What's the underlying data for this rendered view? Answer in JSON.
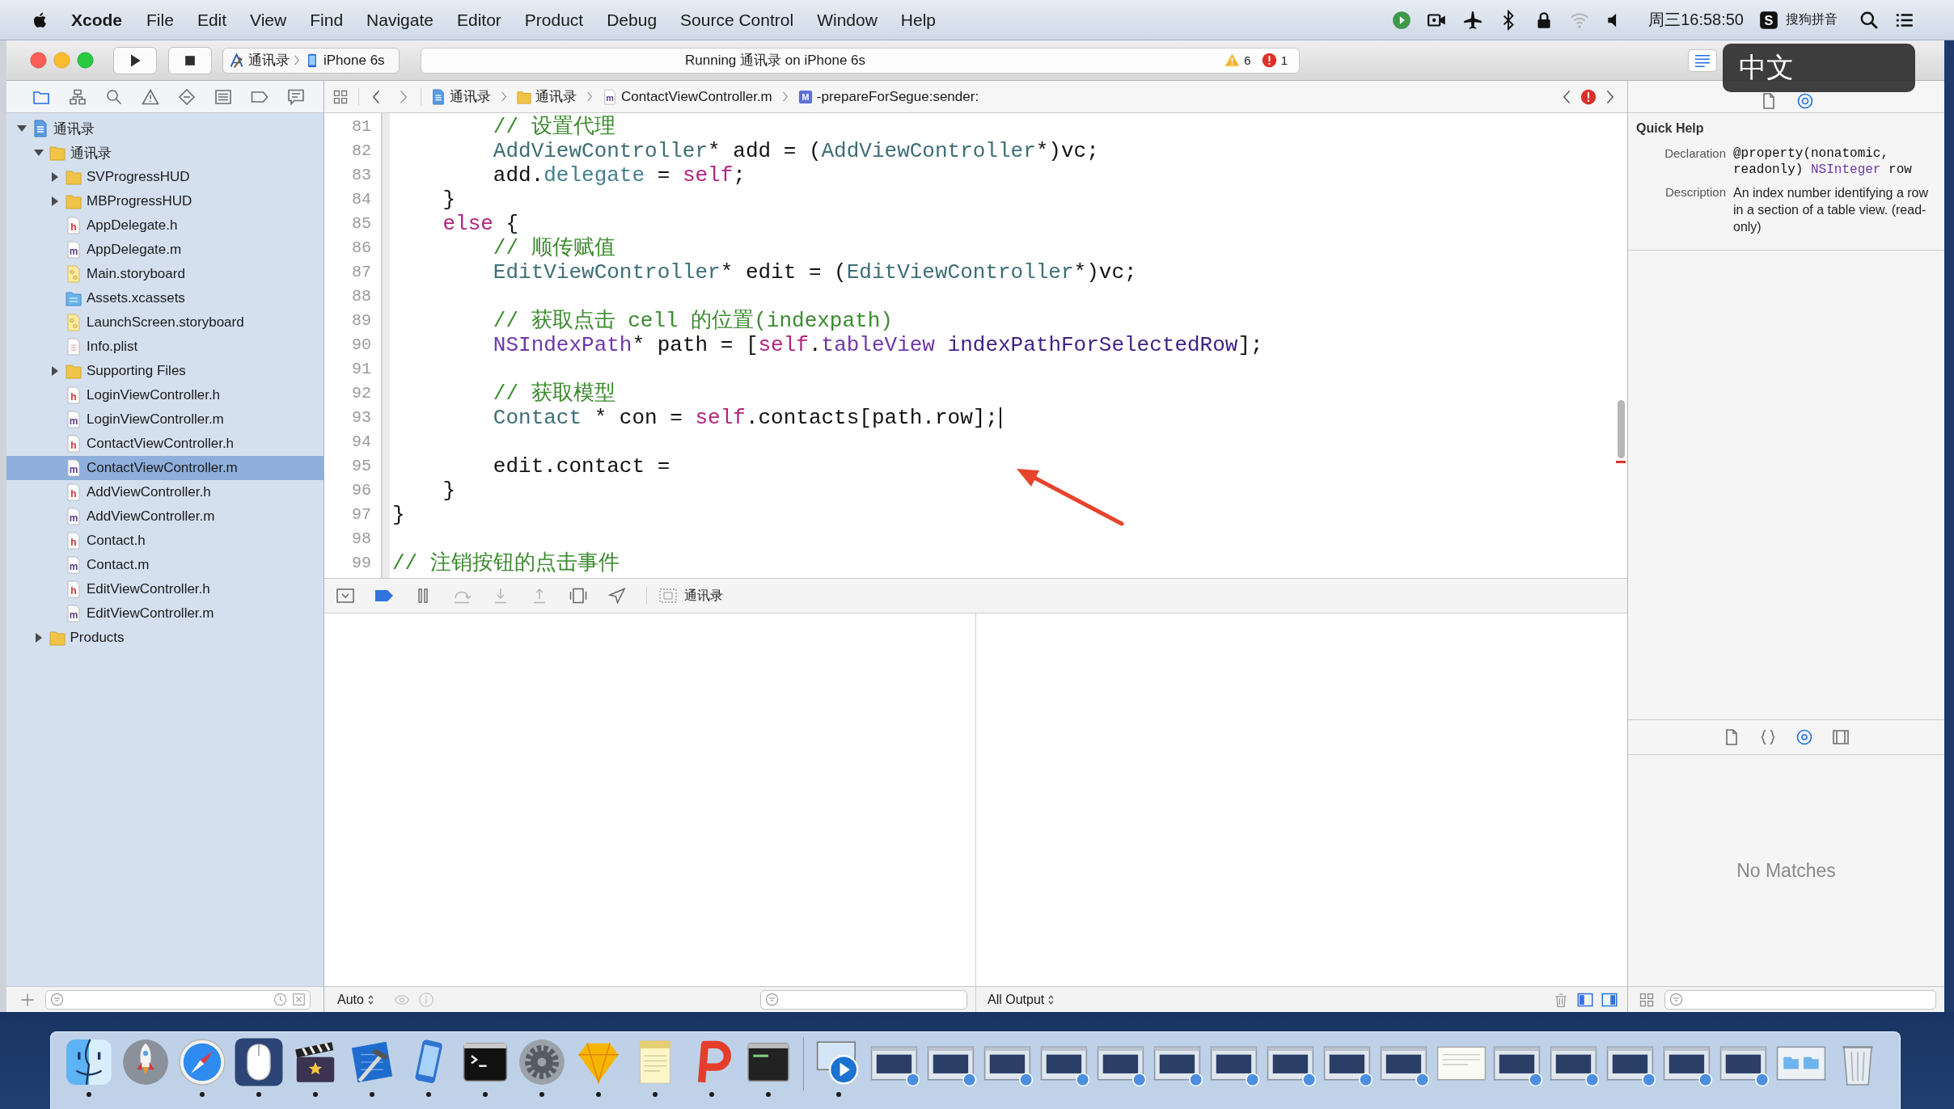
{
  "menu_bar": {
    "app": "Xcode",
    "items": [
      "File",
      "Edit",
      "View",
      "Find",
      "Navigate",
      "Editor",
      "Product",
      "Debug",
      "Source Control",
      "Window",
      "Help"
    ],
    "clock": "周三16:58:50",
    "input_method": {
      "badge": "S",
      "label": "搜狗拼音"
    }
  },
  "toolbar": {
    "scheme": "通讯录",
    "device": "iPhone 6s",
    "activity": "Running 通讯录 on iPhone 6s",
    "warnings": "6",
    "errors": "1",
    "standard_editor": {
      "selected": true
    }
  },
  "ime_popup": {
    "text": "中文"
  },
  "navigator": {
    "tabs": [
      {
        "kind": "project",
        "selected": true
      },
      {
        "kind": "symbol",
        "selected": false
      },
      {
        "kind": "find",
        "selected": false
      },
      {
        "kind": "issue",
        "selected": false
      },
      {
        "kind": "test",
        "selected": false
      },
      {
        "kind": "debug",
        "selected": false
      },
      {
        "kind": "breakpoint",
        "selected": false
      },
      {
        "kind": "report",
        "selected": false
      }
    ],
    "tree": [
      {
        "label": "通讯录",
        "kind": "project",
        "expanded": true,
        "selected": false,
        "children": [
          {
            "label": "通讯录",
            "kind": "folder",
            "expanded": true,
            "selected": false,
            "children": [
              {
                "label": "SVProgressHUD",
                "kind": "folder",
                "expanded": false,
                "selected": false
              },
              {
                "label": "MBProgressHUD",
                "kind": "folder",
                "expanded": false,
                "selected": false
              },
              {
                "label": "AppDelegate.h",
                "kind": "header",
                "badge": "h",
                "selected": false
              },
              {
                "label": "AppDelegate.m",
                "kind": "source",
                "badge": "m",
                "selected": false
              },
              {
                "label": "Main.storyboard",
                "kind": "storyboard",
                "selected": false
              },
              {
                "label": "Assets.xcassets",
                "kind": "assets",
                "selected": false
              },
              {
                "label": "LaunchScreen.storyboard",
                "kind": "storyboard",
                "selected": false
              },
              {
                "label": "Info.plist",
                "kind": "plist",
                "selected": false
              },
              {
                "label": "Supporting Files",
                "kind": "folder",
                "expanded": false,
                "selected": false
              },
              {
                "label": "LoginViewController.h",
                "kind": "header",
                "badge": "h",
                "selected": false
              },
              {
                "label": "LoginViewController.m",
                "kind": "source",
                "badge": "m",
                "selected": false
              },
              {
                "label": "ContactViewController.h",
                "kind": "header",
                "badge": "h",
                "selected": false
              },
              {
                "label": "ContactViewController.m",
                "kind": "source",
                "badge": "m",
                "selected": true
              },
              {
                "label": "AddViewController.h",
                "kind": "header",
                "badge": "h",
                "selected": false
              },
              {
                "label": "AddViewController.m",
                "kind": "source",
                "badge": "m",
                "selected": false
              },
              {
                "label": "Contact.h",
                "kind": "header",
                "badge": "h",
                "selected": false
              },
              {
                "label": "Contact.m",
                "kind": "source",
                "badge": "m",
                "selected": false
              },
              {
                "label": "EditViewController.h",
                "kind": "header",
                "badge": "h",
                "selected": false
              },
              {
                "label": "EditViewController.m",
                "kind": "source",
                "badge": "m",
                "selected": false
              }
            ]
          },
          {
            "label": "Products",
            "kind": "folder",
            "expanded": false,
            "selected": false
          }
        ]
      }
    ]
  },
  "jump_bar": {
    "path": [
      {
        "kind": "project",
        "label": "通讯录"
      },
      {
        "kind": "folder",
        "label": "通讯录"
      },
      {
        "kind": "source",
        "badge": "m",
        "label": "ContactViewController.m"
      },
      {
        "kind": "method",
        "badge": "M",
        "label": "-prepareForSegue:sender:"
      }
    ]
  },
  "editor": {
    "lines": [
      {
        "number": "81",
        "cursor": false,
        "tokens": [
          {
            "text": "        // 设置代理",
            "kind": "comment"
          }
        ]
      },
      {
        "number": "82",
        "cursor": false,
        "tokens": [
          {
            "text": "        AddViewController",
            "kind": "project-class"
          },
          {
            "text": "* add = (",
            "kind": "plain"
          },
          {
            "text": "AddViewController",
            "kind": "project-class"
          },
          {
            "text": "*)vc;",
            "kind": "plain"
          }
        ]
      },
      {
        "number": "83",
        "cursor": false,
        "tokens": [
          {
            "text": "        add.",
            "kind": "plain"
          },
          {
            "text": "delegate",
            "kind": "project-member"
          },
          {
            "text": " = ",
            "kind": "plain"
          },
          {
            "text": "self",
            "kind": "keyword"
          },
          {
            "text": ";",
            "kind": "plain"
          }
        ]
      },
      {
        "number": "84",
        "cursor": false,
        "tokens": [
          {
            "text": "    }",
            "kind": "plain"
          }
        ]
      },
      {
        "number": "85",
        "cursor": false,
        "tokens": [
          {
            "text": "    else",
            "kind": "keyword"
          },
          {
            "text": " {",
            "kind": "plain"
          }
        ]
      },
      {
        "number": "86",
        "cursor": false,
        "tokens": [
          {
            "text": "        // 顺传赋值",
            "kind": "comment"
          }
        ]
      },
      {
        "number": "87",
        "cursor": false,
        "tokens": [
          {
            "text": "        EditViewController",
            "kind": "project-class"
          },
          {
            "text": "* edit = (",
            "kind": "plain"
          },
          {
            "text": "EditViewController",
            "kind": "project-class"
          },
          {
            "text": "*)vc;",
            "kind": "plain"
          }
        ]
      },
      {
        "number": "88",
        "cursor": false
      },
      {
        "number": "89",
        "cursor": false,
        "tokens": [
          {
            "text": "        // 获取点击 cell 的位置(indexpath)",
            "kind": "comment"
          }
        ]
      },
      {
        "number": "90",
        "cursor": false,
        "tokens": [
          {
            "text": "        NSIndexPath",
            "kind": "system-class"
          },
          {
            "text": "* path = [",
            "kind": "plain"
          },
          {
            "text": "self",
            "kind": "keyword"
          },
          {
            "text": ".",
            "kind": "plain"
          },
          {
            "text": "tableView",
            "kind": "system-member"
          },
          {
            "text": " indexPathForSelectedRow",
            "kind": "system-method"
          },
          {
            "text": "];",
            "kind": "plain"
          }
        ]
      },
      {
        "number": "91",
        "cursor": false
      },
      {
        "number": "92",
        "cursor": false,
        "tokens": [
          {
            "text": "        // 获取模型",
            "kind": "comment"
          }
        ]
      },
      {
        "number": "93",
        "cursor": true,
        "tokens": [
          {
            "text": "        Contact",
            "kind": "project-class"
          },
          {
            "text": " * con = ",
            "kind": "plain"
          },
          {
            "text": "self",
            "kind": "keyword"
          },
          {
            "text": ".contacts[path.row];",
            "kind": "plain"
          }
        ]
      },
      {
        "number": "94",
        "cursor": false
      },
      {
        "number": "95",
        "cursor": false,
        "tokens": [
          {
            "text": "        edit.contact =",
            "kind": "plain"
          }
        ]
      },
      {
        "number": "96",
        "cursor": false,
        "tokens": [
          {
            "text": "    }",
            "kind": "plain"
          }
        ]
      },
      {
        "number": "97",
        "cursor": false,
        "tokens": [
          {
            "text": "}",
            "kind": "plain"
          }
        ]
      },
      {
        "number": "98",
        "cursor": false
      },
      {
        "number": "99",
        "cursor": false,
        "tokens": [
          {
            "text": "// 注销按钮的点击事件",
            "kind": "comment"
          }
        ]
      }
    ]
  },
  "debug_bar": {
    "breakpoints_on": true,
    "process": "通讯录"
  },
  "debug_area": {
    "scope": "Auto",
    "output": "All Output"
  },
  "inspector": {
    "tabs": [
      {
        "kind": "file",
        "selected": false
      },
      {
        "kind": "quick-help",
        "selected": true
      }
    ],
    "quick_help": {
      "title": "Quick Help",
      "fields": [
        {
          "label": "Declaration",
          "kind": "code",
          "tokens": [
            {
              "text": "@property(nonatomic, readonly) ",
              "kind": "plain"
            },
            {
              "text": "NSInteger",
              "kind": "system-class"
            },
            {
              "text": " row",
              "kind": "plain"
            }
          ]
        },
        {
          "label": "Description",
          "kind": "text",
          "text": "An index number identifying a row in a section of a table view. (read-only)"
        }
      ]
    },
    "library": {
      "tabs": [
        {
          "kind": "file-template",
          "selected": false
        },
        {
          "kind": "code-snippet",
          "selected": false
        },
        {
          "kind": "object",
          "selected": true
        },
        {
          "kind": "media",
          "selected": false
        }
      ],
      "empty_text": "No Matches"
    }
  },
  "dock": {
    "items": [
      {
        "kind": "face",
        "running": true
      },
      {
        "kind": "rocket",
        "running": false
      },
      {
        "kind": "compass",
        "running": true
      },
      {
        "kind": "mouse",
        "running": true
      },
      {
        "kind": "clapperboard",
        "running": true
      },
      {
        "kind": "hammer",
        "running": true
      },
      {
        "kind": "phone",
        "running": true
      },
      {
        "kind": "terminal",
        "running": true
      },
      {
        "kind": "gear",
        "running": true
      },
      {
        "kind": "diamond",
        "running": true
      },
      {
        "kind": "notepad",
        "running": true
      },
      {
        "kind": "p-logo",
        "running": true
      },
      {
        "kind": "console",
        "running": true
      },
      {
        "kind": "separator"
      },
      {
        "kind": "player",
        "running": true
      },
      {
        "kind": "window"
      },
      {
        "kind": "window"
      },
      {
        "kind": "window"
      },
      {
        "kind": "window"
      },
      {
        "kind": "window"
      },
      {
        "kind": "window"
      },
      {
        "kind": "window"
      },
      {
        "kind": "window"
      },
      {
        "kind": "window"
      },
      {
        "kind": "window"
      },
      {
        "kind": "document"
      },
      {
        "kind": "window"
      },
      {
        "kind": "window"
      },
      {
        "kind": "window"
      },
      {
        "kind": "window"
      },
      {
        "kind": "window"
      },
      {
        "kind": "folder-window"
      },
      {
        "kind": "trash"
      }
    ]
  }
}
